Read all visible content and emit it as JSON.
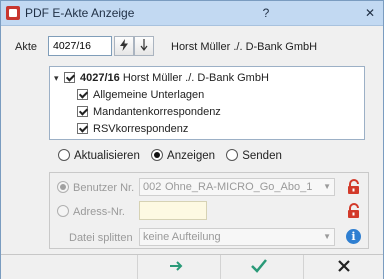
{
  "window": {
    "title": "PDF E-Akte Anzeige",
    "help_label": "?",
    "close_label": "✕"
  },
  "akte": {
    "label": "Akte",
    "value": "4027/16",
    "lookup_icon": "lightning-icon",
    "sort_icon": "arrow-down-icon",
    "name": "Horst Müller ./. D-Bank GmbH"
  },
  "tree": {
    "root": {
      "expander": "▾",
      "number": "4027/16",
      "name": "Horst Müller ./. D-Bank GmbH",
      "checked": true
    },
    "children": [
      {
        "label": "Allgemeine Unterlagen",
        "checked": true
      },
      {
        "label": "Mandantenkorrespondenz",
        "checked": true
      },
      {
        "label": "RSVkorrespondenz",
        "checked": true
      }
    ]
  },
  "mode": {
    "options": [
      "Aktualisieren",
      "Anzeigen",
      "Senden"
    ],
    "selected": "Anzeigen"
  },
  "settings": {
    "benutzer_label": "Benutzer Nr.",
    "benutzer_number": "002",
    "benutzer_value": "Ohne_RA-MICRO_Go_Abo_1",
    "adress_label": "Adress-Nr.",
    "adress_value": "",
    "datei_label": "Datei splitten",
    "datei_value": "keine Aufteilung",
    "info_label": "i"
  },
  "footer": {
    "next_icon": "arrow-right-icon",
    "ok_icon": "checkmark-icon",
    "cancel_icon": "x-icon"
  },
  "colors": {
    "accent_green": "#2a9a78",
    "lock_red": "#d23a2a",
    "info_blue": "#2f7fd1"
  }
}
